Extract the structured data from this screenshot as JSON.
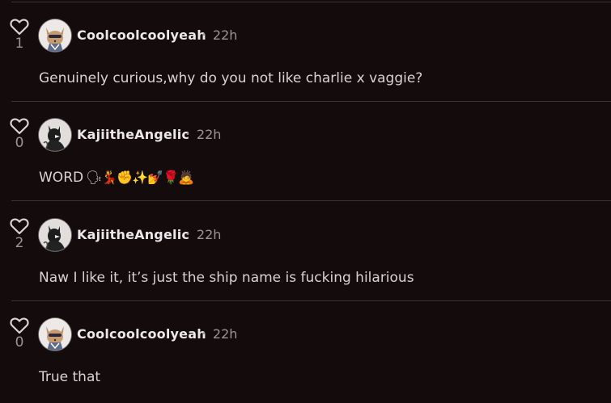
{
  "comments": [
    {
      "likes": "1",
      "username": "Coolcoolcoolyeah",
      "separator": "•",
      "time": "22h",
      "text": "Genuinely curious,why do you not like charlie x vaggie?",
      "emojis": ""
    },
    {
      "likes": "0",
      "username": "KajiitheAngelic",
      "separator": "•",
      "time": "22h",
      "text": "WORD",
      "emojis": "🗣💃✊✨💅🌹🙇"
    },
    {
      "likes": "2",
      "username": "KajiitheAngelic",
      "separator": "•",
      "time": "22h",
      "text": "Naw I like it, it’s just the ship name is fucking hilarious",
      "emojis": ""
    },
    {
      "likes": "0",
      "username": "Coolcoolcoolyeah",
      "separator": "•",
      "time": "22h",
      "text": "True that",
      "emojis": ""
    }
  ],
  "icons": {
    "like": "heart-outline-icon",
    "avatar_a": "fox-avatar",
    "avatar_b": "dark-figure-avatar"
  },
  "colors": {
    "background": "#140b0d",
    "divider": "#3a3234",
    "username": "#ece7e8",
    "meta": "#9c9597",
    "body": "#d9d3d4"
  }
}
